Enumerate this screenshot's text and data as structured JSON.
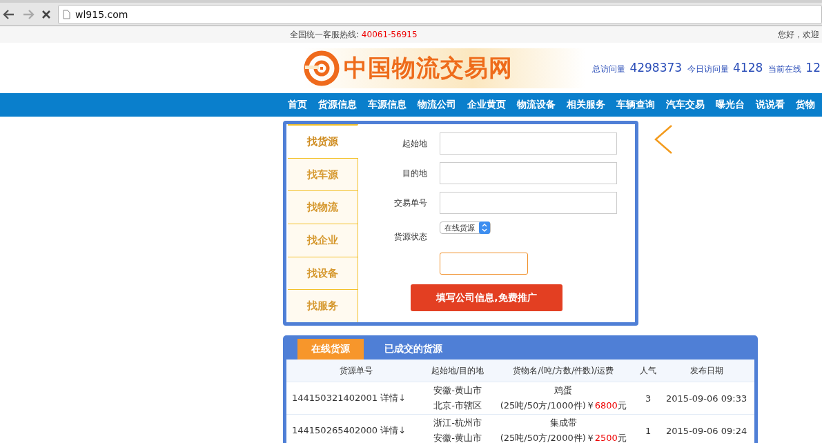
{
  "browser": {
    "url": "wl915.com",
    "forward_disabled": true
  },
  "topbar": {
    "hotline_label": "全国统一客服热线:",
    "hotline_number": "40061-56915",
    "greeting": "您好，欢迎"
  },
  "header": {
    "logo_text": "中国物流交易网",
    "stats": [
      {
        "label": "总访问量",
        "value": "4298373"
      },
      {
        "label": "今日访问量",
        "value": "4128"
      },
      {
        "label": "当前在线",
        "value": "12"
      }
    ]
  },
  "nav": [
    "首页",
    "货源信息",
    "车源信息",
    "物流公司",
    "企业黄页",
    "物流设备",
    "相关服务",
    "车辆查询",
    "汽车交易",
    "曝光台",
    "说说看",
    "货物"
  ],
  "search": {
    "tabs": [
      {
        "label": "找货源",
        "selected": true
      },
      {
        "label": "找车源",
        "selected": false
      },
      {
        "label": "找物流",
        "selected": false
      },
      {
        "label": "找企业",
        "selected": false
      },
      {
        "label": "找设备",
        "selected": false
      },
      {
        "label": "找服务",
        "selected": false
      }
    ],
    "fields": [
      {
        "kind": "text",
        "label": "起始地"
      },
      {
        "kind": "text",
        "label": "目的地"
      },
      {
        "kind": "text",
        "label": "交易单号"
      },
      {
        "kind": "select",
        "label": "货源状态",
        "value": "在线货源"
      },
      {
        "kind": "code"
      }
    ],
    "button": "填写公司信息,免费推广"
  },
  "listing": {
    "tabs": [
      {
        "label": "在线货源",
        "selected": true
      },
      {
        "label": "已成交的货源",
        "selected": false
      }
    ],
    "columns": [
      "货源单号",
      "起始地/目的地",
      "货物名/(吨/方数/件数)/运费",
      "人气",
      "发布日期"
    ],
    "rows": [
      {
        "id": "144150321402001",
        "detail": "详情↓",
        "origin": "安徽-黄山市",
        "destination": "北京-市辖区",
        "goods": "鸡蛋",
        "specs": "(25吨/50方/1000件)",
        "currency": "￥",
        "price": "6800",
        "unit": "元",
        "popularity": "3",
        "date": "2015-09-06 09:33"
      },
      {
        "id": "144150265402000",
        "detail": "详情↓",
        "origin": "浙江-杭州市",
        "destination": "安徽-黄山市",
        "goods": "集成带",
        "specs": "(25吨/50方/2000件)",
        "currency": "￥",
        "price": "2500",
        "unit": "元",
        "popularity": "1",
        "date": "2015-09-06 09:24"
      }
    ]
  }
}
